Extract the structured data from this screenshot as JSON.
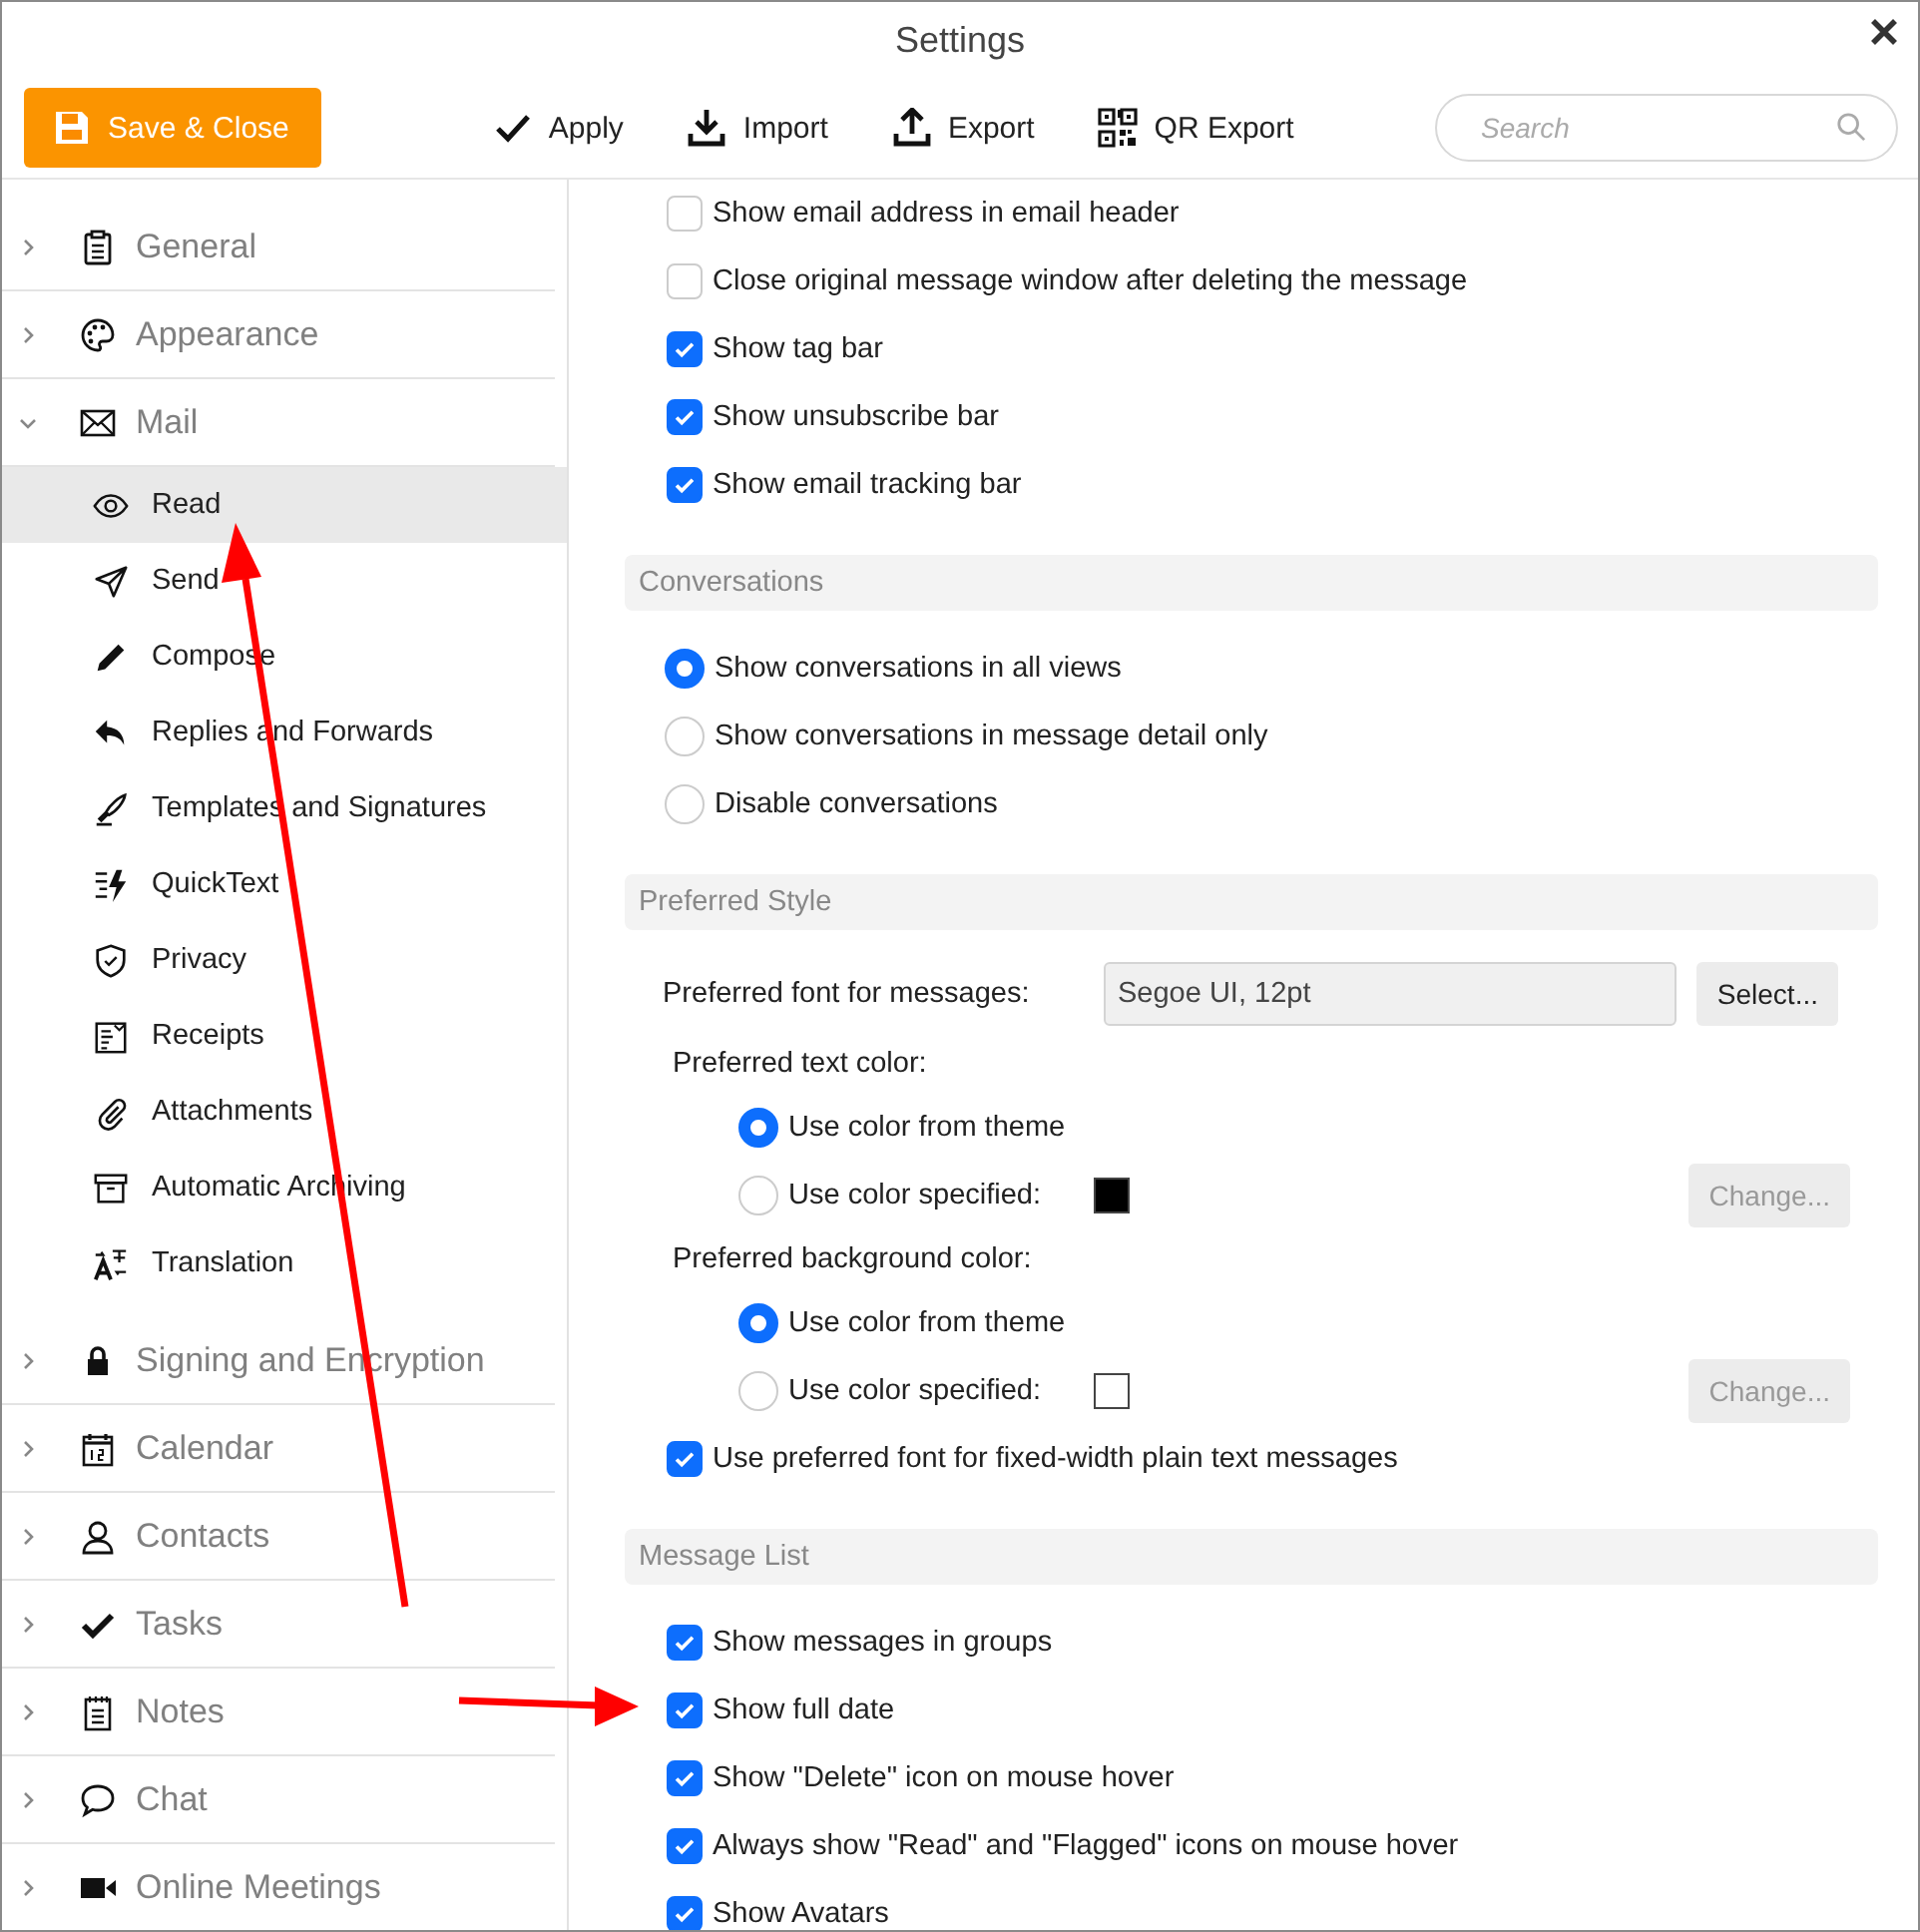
{
  "window": {
    "title": "Settings"
  },
  "toolbar": {
    "save_button": "Save & Close",
    "actions": [
      {
        "label": "Apply"
      },
      {
        "label": "Import"
      },
      {
        "label": "Export"
      },
      {
        "label": "QR Export"
      }
    ],
    "search": {
      "placeholder": "Search"
    }
  },
  "sidebar": {
    "items": [
      {
        "label": "General",
        "expanded": false
      },
      {
        "label": "Appearance",
        "expanded": false
      },
      {
        "label": "Mail",
        "expanded": true,
        "children": [
          {
            "label": "Read",
            "selected": true
          },
          {
            "label": "Send",
            "selected": false
          },
          {
            "label": "Compose",
            "selected": false
          },
          {
            "label": "Replies and Forwards",
            "selected": false
          },
          {
            "label": "Templates and Signatures",
            "selected": false
          },
          {
            "label": "QuickText",
            "selected": false
          },
          {
            "label": "Privacy",
            "selected": false
          },
          {
            "label": "Receipts",
            "selected": false
          },
          {
            "label": "Attachments",
            "selected": false
          },
          {
            "label": "Automatic Archiving",
            "selected": false
          },
          {
            "label": "Translation",
            "selected": false
          }
        ]
      },
      {
        "label": "Signing and Encryption",
        "expanded": false
      },
      {
        "label": "Calendar",
        "expanded": false
      },
      {
        "label": "Contacts",
        "expanded": false
      },
      {
        "label": "Tasks",
        "expanded": false
      },
      {
        "label": "Notes",
        "expanded": false
      },
      {
        "label": "Chat",
        "expanded": false
      },
      {
        "label": "Online Meetings",
        "expanded": false
      }
    ]
  },
  "sections": [
    {
      "items": [
        {
          "kind": "checkbox",
          "label": "Show email address in email header",
          "checked": false
        },
        {
          "kind": "checkbox",
          "label": "Close original message window after deleting the message",
          "checked": false
        },
        {
          "kind": "checkbox",
          "label": "Show tag bar",
          "checked": true
        },
        {
          "kind": "checkbox",
          "label": "Show unsubscribe bar",
          "checked": true
        },
        {
          "kind": "checkbox",
          "label": "Show email tracking bar",
          "checked": true
        }
      ]
    },
    {
      "title": "Conversations",
      "items": [
        {
          "kind": "radio",
          "label": "Show conversations in all views",
          "selected": true
        },
        {
          "kind": "radio",
          "label": "Show conversations in message detail only",
          "selected": false
        },
        {
          "kind": "radio",
          "label": "Disable conversations",
          "selected": false
        }
      ]
    },
    {
      "title": "Preferred Style",
      "items": [
        {
          "kind": "font",
          "label": "Preferred font for messages:",
          "value": "Segoe UI, 12pt",
          "button": {
            "label": "Select...",
            "disabled": false
          }
        },
        {
          "kind": "group",
          "label": "Preferred text color:",
          "children": [
            {
              "kind": "radio",
              "label": "Use color from theme",
              "selected": true
            },
            {
              "kind": "color",
              "label": "Use color specified:",
              "selected": false,
              "color": "#000000",
              "button": {
                "label": "Change...",
                "disabled": true
              }
            }
          ]
        },
        {
          "kind": "group",
          "label": "Preferred background color:",
          "children": [
            {
              "kind": "radio",
              "label": "Use color from theme",
              "selected": true
            },
            {
              "kind": "color",
              "label": "Use color specified:",
              "selected": false,
              "color": "#ffffff",
              "button": {
                "label": "Change...",
                "disabled": true
              }
            }
          ]
        },
        {
          "kind": "checkbox",
          "label": "Use preferred font for fixed-width plain text messages",
          "checked": true
        }
      ]
    },
    {
      "title": "Message List",
      "items": [
        {
          "kind": "checkbox",
          "label": "Show messages in groups",
          "checked": true
        },
        {
          "kind": "checkbox",
          "label": "Show full date",
          "checked": true
        },
        {
          "kind": "checkbox",
          "label": "Show \"Delete\" icon on mouse hover",
          "checked": true
        },
        {
          "kind": "checkbox",
          "label": "Always show \"Read\" and \"Flagged\" icons on mouse hover",
          "checked": true
        },
        {
          "kind": "checkbox",
          "label": "Show Avatars",
          "checked": true
        }
      ]
    }
  ]
}
